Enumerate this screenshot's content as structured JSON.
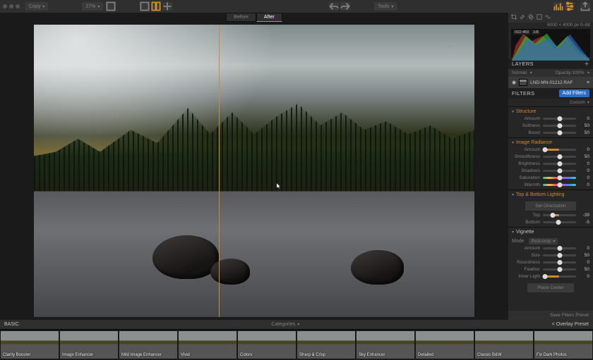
{
  "toolbar": {
    "copy_label": "Copy",
    "zoom_label": "27%",
    "tools_label": "Tools"
  },
  "compare": {
    "before": "Before",
    "after": "After"
  },
  "side": {
    "dimensions": "6000 × 4000 px   0–bit",
    "iso": "ISO 450",
    "shutter": "1/8",
    "layers_title": "LAYERS",
    "blend_mode": "Normal",
    "opacity_lbl": "Opacity:",
    "opacity_val": "100%",
    "layer_name": "LND-MN-01212.RAF",
    "filters_title": "FILTERS",
    "add_filters": "Add Filters",
    "custom": "Custom",
    "set_orientation": "Set Orientation",
    "place_center": "Place Center",
    "mode_label": "Mode",
    "mode_value": "Post-crop",
    "save_preset": "Save Filters Preset"
  },
  "panels": {
    "structure": {
      "title": "Structure",
      "sliders": [
        {
          "label": "Amount",
          "value": 0,
          "pos": 50
        },
        {
          "label": "Softness",
          "value": 50,
          "pos": 50
        },
        {
          "label": "Boost",
          "value": 50,
          "pos": 50
        }
      ]
    },
    "radiance": {
      "title": "Image Radiance",
      "sliders": [
        {
          "label": "Amount",
          "value": 0,
          "pos": 6
        },
        {
          "label": "Smoothness",
          "value": 50,
          "pos": 50
        },
        {
          "label": "Brightness",
          "value": 0,
          "pos": 50
        },
        {
          "label": "Shadows",
          "value": 0,
          "pos": 50
        },
        {
          "label": "Saturation",
          "value": 0,
          "pos": 50,
          "grad": true
        },
        {
          "label": "Warmth",
          "value": 0,
          "pos": 50,
          "grad": true
        }
      ]
    },
    "topbottom": {
      "title": "Top & Bottom Lighting",
      "sliders": [
        {
          "label": "Top",
          "value": -39,
          "pos": 30
        },
        {
          "label": "Bottom",
          "value": -5,
          "pos": 47
        }
      ]
    },
    "vignette": {
      "title": "Vignette",
      "sliders": [
        {
          "label": "Amount",
          "value": 0,
          "pos": 50
        },
        {
          "label": "Size",
          "value": 50,
          "pos": 50
        },
        {
          "label": "Roundness",
          "value": 0,
          "pos": 50
        },
        {
          "label": "Feather",
          "value": 50,
          "pos": 50
        },
        {
          "label": "Inner Light",
          "value": 0,
          "pos": 6
        }
      ]
    }
  },
  "filmstrip": {
    "basic": "BASIC",
    "categories": "Categories",
    "overlay": "< Overlay Preset",
    "thumbs": [
      "Clarity Booster",
      "Image Enhancer",
      "Mild Image Enhancer",
      "Vivid",
      "Colors",
      "Sharp & Crisp",
      "Sky Enhancer",
      "Detailed",
      "Classic B&W",
      "Fix Dark Photos"
    ]
  }
}
